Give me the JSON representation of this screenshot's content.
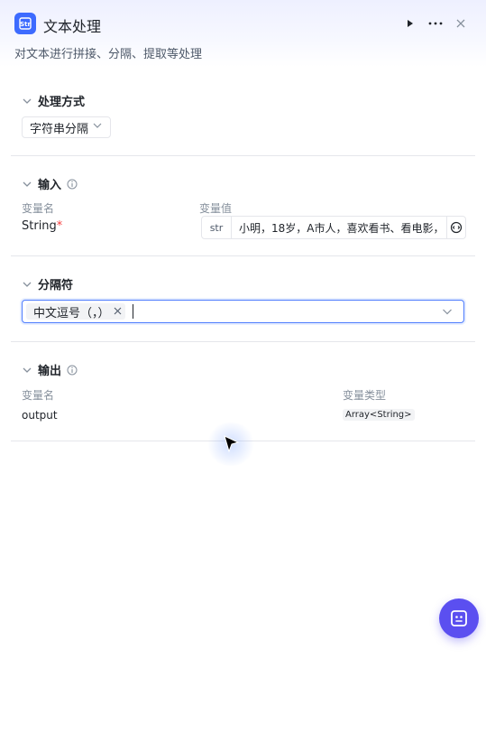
{
  "header": {
    "title": "文本处理",
    "subtitle": "对文本进行拼接、分隔、提取等处理",
    "actions": [
      "play-icon",
      "more-icon",
      "close-icon"
    ]
  },
  "process": {
    "section_title": "处理方式",
    "mode": "字符串分隔"
  },
  "input": {
    "section_title": "输入",
    "col_name": "变量名",
    "col_value": "变量值",
    "var_name": "String",
    "required_mark": "*",
    "type_tag": "str",
    "value": "小明，18岁，A市人，喜欢看书、看电影，"
  },
  "delimiter": {
    "section_title": "分隔符",
    "selected": "中文逗号（，）"
  },
  "output": {
    "section_title": "输出",
    "col_name": "变量名",
    "col_type": "变量类型",
    "var_name": "output",
    "var_type": "Array<String>"
  },
  "colors": {
    "accent": "#4d7cfe",
    "fab": "#5b4ff0",
    "app_icon": "#3d6bff"
  }
}
